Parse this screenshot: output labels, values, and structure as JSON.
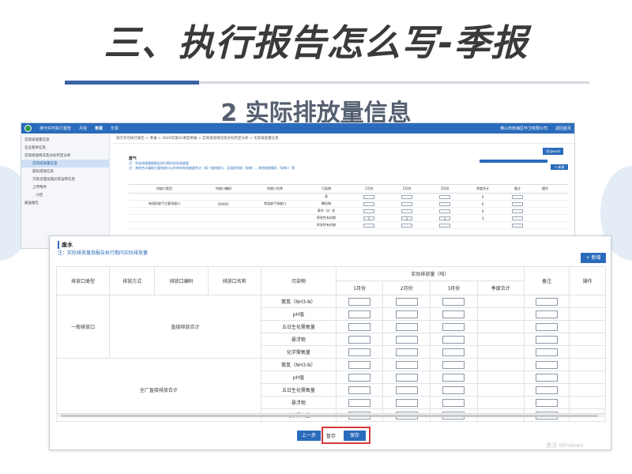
{
  "slide": {
    "title": "三、执行报告怎么写-季报",
    "subtitle": "2 实际排放量信息"
  },
  "back": {
    "app_name": "排污许可执行报告",
    "nav": [
      "月报",
      "季报",
      "年报"
    ],
    "active_nav": "季报",
    "company": "佛山市南海区环卫有限公司",
    "return_label": "返回首页",
    "sidebar": [
      {
        "label": "实际排放量信息",
        "active": false
      },
      {
        "label": "企业基本信息",
        "active": false
      },
      {
        "label": "实际排放情况及达标判定分析",
        "active": false
      },
      {
        "label": "实际排放量信息",
        "active": true
      },
      {
        "label": "超标排放信息",
        "active": false
      },
      {
        "label": "污染治理设施异常运转信息",
        "active": false
      },
      {
        "label": "上传附件",
        "active": false
      },
      {
        "label": "小结",
        "active": false
      },
      {
        "label": "报送报告",
        "active": false
      }
    ],
    "breadcrumb": "排污许可执行报告 > 季报 > 2020年第01季度季报 > 实际排放情况及达标判定分析 > 实际排放量信息",
    "export_label": "导出word",
    "section_title": "废气",
    "note_lines": [
      "注：实际排放量指报告执行期内实际排放量",
      "注：其他合计填报主要排放口以外的所有排放量合计（如一般排放口、无组织排放（如有），其他排放情形（如有））等"
    ],
    "add_label": "+ 新增",
    "headers": [
      "排放口类型",
      "排放口编码",
      "排放口名称",
      "污染物",
      "实际排放量（吨）",
      "1月份",
      "2月份",
      "3月份",
      "季度合计",
      "备注",
      "操作"
    ],
    "row": {
      "outlet_type": "有组织废气主要排放口",
      "outlet_code": "DA001",
      "outlet_name": "焚烧废气排放口",
      "pollutants": [
        "汞",
        "颗粒物",
        "苯并（a）芘",
        "挥发性有机物",
        "挥发性有机物"
      ],
      "quarter_totals": [
        "0",
        "0",
        "0",
        "3",
        ""
      ],
      "inputs": [
        [
          "",
          "",
          ""
        ],
        [
          "",
          "",
          ""
        ],
        [
          "",
          "",
          ""
        ],
        [
          "1",
          "1",
          "1"
        ],
        [
          "",
          "",
          ""
        ]
      ]
    }
  },
  "front": {
    "section_title": "废水",
    "note": "注：实际排放量指报告执行期内实际排放量",
    "add_label": "+ 新增",
    "headers": {
      "outlet_type": "排放口类型",
      "discharge_method": "排放方式",
      "outlet_code": "排放口编码",
      "outlet_name": "排放口名称",
      "pollutant": "污染物",
      "actual": "实际排放量（吨）",
      "months": [
        "1月份",
        "2月份",
        "3月份"
      ],
      "quarter_total": "季度合计",
      "remark": "备注",
      "operation": "操作"
    },
    "groups": [
      {
        "outlet_type": "一般排放口",
        "outlet_name": "直接排放合计",
        "pollutants": [
          "氨氮（NH3-N）",
          "pH值",
          "五日生化需氧量",
          "悬浮物",
          "化学需氧量"
        ]
      },
      {
        "outlet_type": "",
        "outlet_name": "全厂直接排放合计",
        "pollutants": [
          "氨氮（NH3-N）",
          "pH值",
          "五日生化需氧量",
          "悬浮物",
          "化学需氧量"
        ]
      }
    ],
    "buttons": {
      "prev": "上一步",
      "draft": "暂存",
      "save": "保存"
    },
    "watermark": "激活 Windows"
  },
  "colors": {
    "primary_blue": "#2a6bbb",
    "highlight_red": "#d43a3a",
    "title_line_blue": "#3a64a6"
  }
}
